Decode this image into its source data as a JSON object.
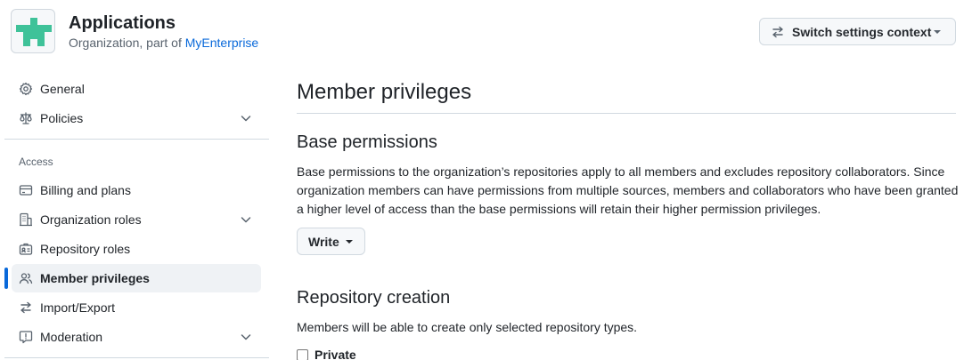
{
  "header": {
    "org_name": "Applications",
    "org_sub_prefix": "Organization, part of",
    "enterprise_link": "MyEnterprise",
    "switch_context_label": "Switch settings context",
    "avatar_color": "#3fc299"
  },
  "sidebar": {
    "items_top": [
      {
        "label": "General",
        "icon": "gear-icon"
      },
      {
        "label": "Policies",
        "icon": "law-icon",
        "expandable": true
      }
    ],
    "access_group_title": "Access",
    "items_access": [
      {
        "label": "Billing and plans",
        "icon": "credit-card-icon"
      },
      {
        "label": "Organization roles",
        "icon": "organization-icon",
        "expandable": true
      },
      {
        "label": "Repository roles",
        "icon": "id-badge-icon"
      },
      {
        "label": "Member privileges",
        "icon": "people-icon",
        "active": true
      },
      {
        "label": "Import/Export",
        "icon": "arrow-switch-icon"
      },
      {
        "label": "Moderation",
        "icon": "report-icon",
        "expandable": true
      }
    ],
    "accent_color": "#0969da"
  },
  "main": {
    "title": "Member privileges",
    "base_permissions": {
      "title": "Base permissions",
      "description": "Base permissions to the organization’s repositories apply to all members and excludes repository collaborators. Since organization members can have permissions from multiple sources, members and collaborators who have been granted a higher level of access than the base permissions will retain their higher permission privileges.",
      "selected_value": "Write"
    },
    "repository_creation": {
      "title": "Repository creation",
      "description": "Members will be able to create only selected repository types.",
      "option_private_label": "Private",
      "option_private_checked": false
    }
  }
}
